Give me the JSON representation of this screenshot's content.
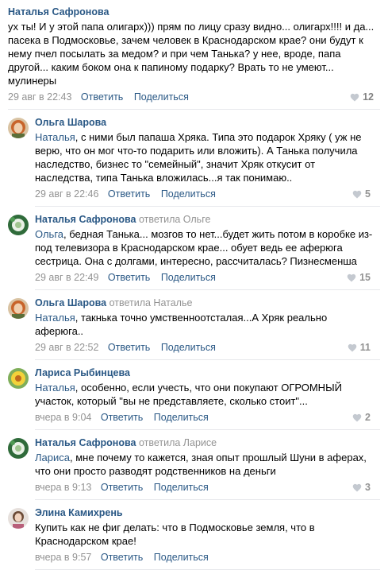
{
  "colors": {
    "link": "#2a5885",
    "muted": "#939393",
    "separator": "#e7e8ec"
  },
  "actions": {
    "reply": "Ответить",
    "share": "Поделиться"
  },
  "root": {
    "author": "Наталья Сафронова",
    "text": "ух ты! И у этой папа олигарх))) прям по лицу сразу видно... олигарх!!!! и да... пасека в Подмосковье, зачем человек в Краснодарском крае? они будут к нему пчел посылать за медом? и при чем Танька? у нее, вроде, папа другой... каким боком она к папиному подарку? Врать то не умеют... мулинеры",
    "date": "29 авг в 22:43",
    "likes": "12"
  },
  "replies": [
    {
      "author": "Ольга Шарова",
      "replied_to": "",
      "avatar_icon": "orange-haired-woman-avatar",
      "mention": "Наталья",
      "text": ", с ними был папаша Хряка. Типа это подарок Хряку ( уж не верю, что он мог что-то подарить или вложить). А Танька получила наследство, бизнес то \"семейный\", значит Хряк откусит от наследства, типа Танька вложилась...я так понимаю..",
      "date": "29 авг в 22:46",
      "likes": "5"
    },
    {
      "author": "Наталья Сафронова",
      "replied_to": "ответила Ольге",
      "avatar_icon": "green-flower-avatar",
      "mention": "Ольга",
      "text": ", бедная Танька... мозгов то нет...будет жить потом в коробке из-под телевизора в Краснодарском крае... обует ведь ее аферюга сестрица. Она с долгами, интересно, рассчиталась? Пизнесменша",
      "date": "29 авг в 22:49",
      "likes": "15"
    },
    {
      "author": "Ольга Шарова",
      "replied_to": "ответила Наталье",
      "avatar_icon": "orange-haired-woman-avatar",
      "mention": "Наталья",
      "text": ", такнька точно умственноотсталая...А Хряк реально аферюга..",
      "date": "29 авг в 22:52",
      "likes": "11"
    },
    {
      "author": "Лариса Рыбинцева",
      "replied_to": "",
      "avatar_icon": "yellow-flower-avatar",
      "mention": "Наталья",
      "text": ", особенно, если учесть, что они покупают ОГРОМНЫЙ участок, который \"вы не представляете, сколько стоит\"...",
      "date": "вчера в 9:04",
      "likes": "2"
    },
    {
      "author": "Наталья Сафронова",
      "replied_to": "ответила Ларисе",
      "avatar_icon": "green-flower-avatar",
      "mention": "Лариса",
      "text": ", мне почему то кажется, зная опыт прошлый Шуни в аферах, что они просто разводят родственников на деньги",
      "date": "вчера в 9:13",
      "likes": "3"
    },
    {
      "author": "Элина Камихрень",
      "replied_to": "",
      "avatar_icon": "woman-portrait-avatar",
      "mention": "",
      "text": "Купить как не фиг делать: что в Подмосковье земля, что в Краснодарском крае!",
      "date": "вчера в 9:57",
      "likes": ""
    }
  ]
}
